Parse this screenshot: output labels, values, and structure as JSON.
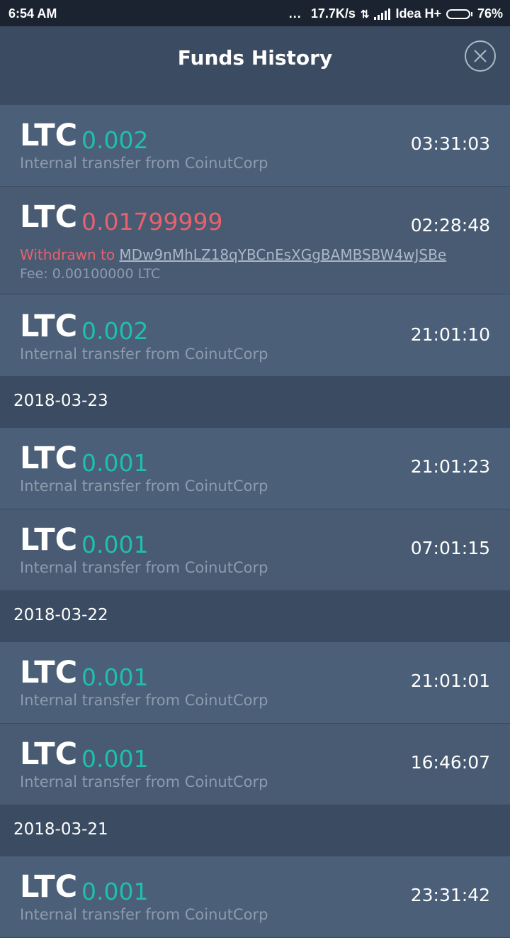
{
  "status_bar": {
    "time": "6:54 AM",
    "dots": "...",
    "speed": "17.7K/s",
    "carrier": "Idea H+",
    "battery": "76%",
    "battery_level": 0.76
  },
  "header": {
    "title": "Funds History",
    "close_icon": "close-circle-icon"
  },
  "transactions_top": [
    {
      "coin": "LTC",
      "amount": "0.002",
      "direction": "in",
      "desc": "Internal transfer from CoinutCorp",
      "time": "03:31:03"
    },
    {
      "coin": "LTC",
      "amount": "0.01799999",
      "direction": "out",
      "withdrawn_label": "Withdrawn to",
      "address": "MDw9nMhLZ18qYBCnEsXGgBAMBSBW4wJSBe",
      "fee": "Fee: 0.00100000 LTC",
      "time": "02:28:48"
    },
    {
      "coin": "LTC",
      "amount": "0.002",
      "direction": "in",
      "desc": "Internal transfer from CoinutCorp",
      "time": "21:01:10"
    }
  ],
  "groups": [
    {
      "date": "2018-03-23",
      "items": [
        {
          "coin": "LTC",
          "amount": "0.001",
          "desc": "Internal transfer from CoinutCorp",
          "time": "21:01:23"
        },
        {
          "coin": "LTC",
          "amount": "0.001",
          "desc": "Internal transfer from CoinutCorp",
          "time": "07:01:15"
        }
      ]
    },
    {
      "date": "2018-03-22",
      "items": [
        {
          "coin": "LTC",
          "amount": "0.001",
          "desc": "Internal transfer from CoinutCorp",
          "time": "21:01:01"
        },
        {
          "coin": "LTC",
          "amount": "0.001",
          "desc": "Internal transfer from CoinutCorp",
          "time": "16:46:07"
        }
      ]
    },
    {
      "date": "2018-03-21",
      "items": [
        {
          "coin": "LTC",
          "amount": "0.001",
          "desc": "Internal transfer from CoinutCorp",
          "time": "23:31:42"
        }
      ]
    }
  ],
  "colors": {
    "positive": "#1fbfae",
    "negative": "#e8616d",
    "background": "#3d4f66"
  }
}
